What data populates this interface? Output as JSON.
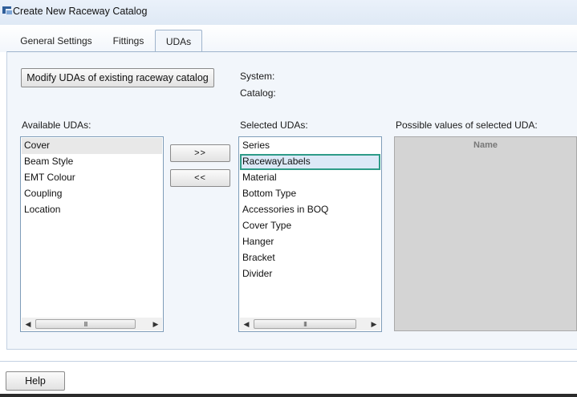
{
  "window": {
    "title": "Create New Raceway Catalog",
    "icon": "raceway-app-icon"
  },
  "tabs": [
    {
      "label": "General Settings"
    },
    {
      "label": "Fittings"
    },
    {
      "label": "UDAs",
      "active": true
    }
  ],
  "udas": {
    "modify_button": "Modify UDAs of existing raceway catalog",
    "system_label": "System:",
    "catalog_label": "Catalog:",
    "available_label": "Available UDAs:",
    "selected_label": "Selected UDAs:",
    "possible_label": "Possible values of selected UDA:",
    "move_right_label": ">>",
    "move_left_label": "<<",
    "available_items": [
      "Cover",
      "Beam Style",
      "EMT Colour",
      "Coupling",
      "Location"
    ],
    "selected_items": [
      "Series",
      "RacewayLabels",
      "Material",
      "Bottom Type",
      "Accessories in BOQ",
      "Cover Type",
      "Hanger",
      "Bracket",
      "Divider"
    ],
    "values_column": "Name",
    "scroll_grip": "III"
  },
  "footer": {
    "help_button": "Help"
  },
  "colors": {
    "focus_outline": "#2e9c88",
    "panel": "#f2f6fb",
    "accent_border": "#9fb4cc"
  }
}
